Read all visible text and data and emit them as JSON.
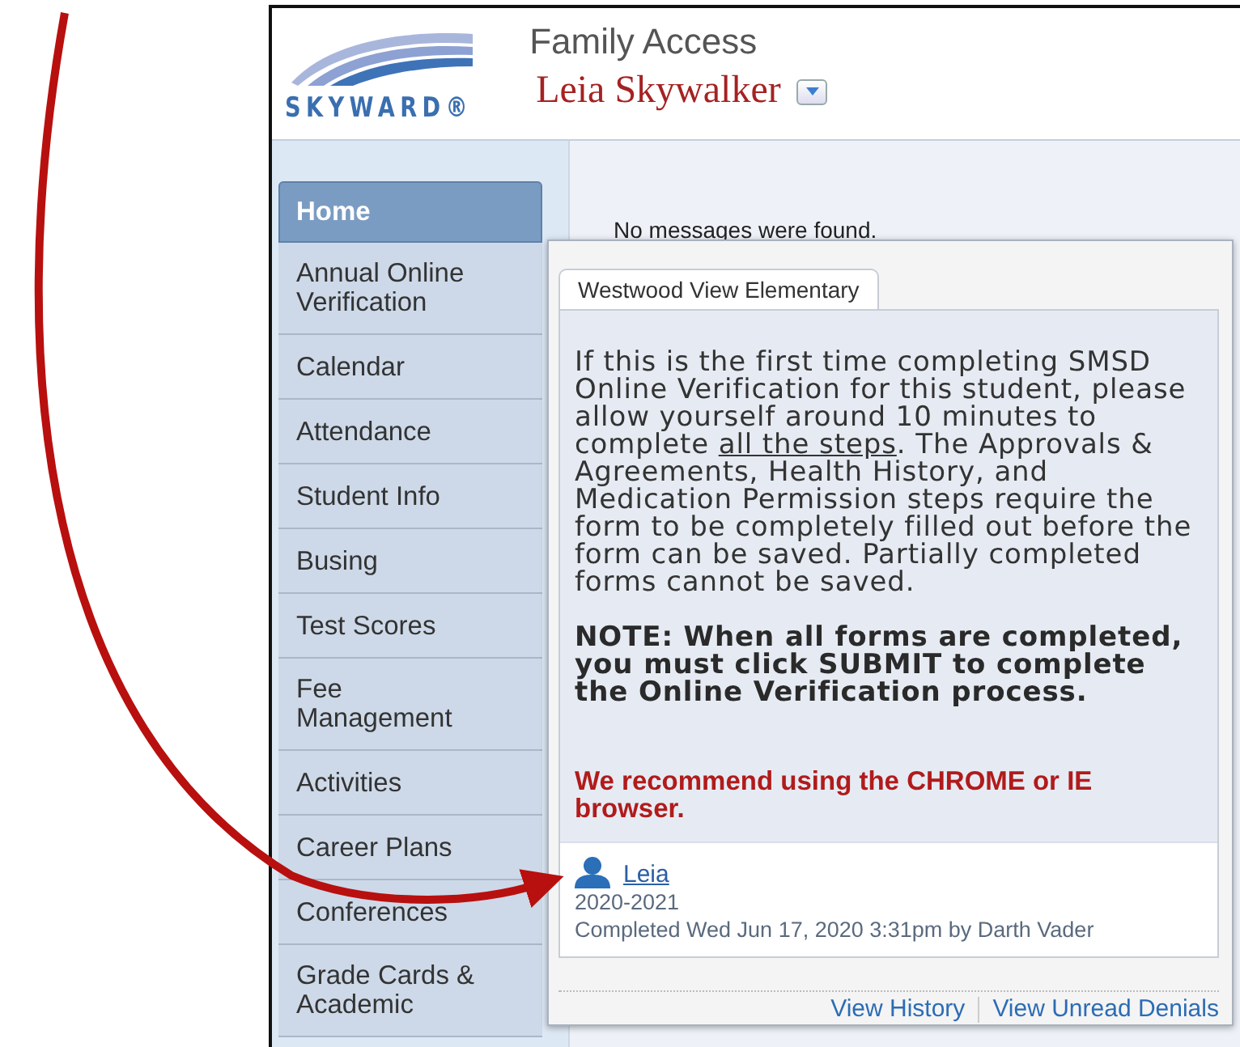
{
  "header": {
    "logo": "SKYWARD®",
    "app_title": "Family Access",
    "student_name": "Leia Skywalker"
  },
  "sidebar": {
    "items": [
      {
        "label": "Home",
        "selected": true
      },
      {
        "label": "Annual Online Verification",
        "selected": false
      },
      {
        "label": "Calendar",
        "selected": false
      },
      {
        "label": "Attendance",
        "selected": false
      },
      {
        "label": "Student Info",
        "selected": false
      },
      {
        "label": "Busing",
        "selected": false
      },
      {
        "label": "Test Scores",
        "selected": false
      },
      {
        "label": "Fee Management",
        "selected": false
      },
      {
        "label": "Activities",
        "selected": false
      },
      {
        "label": "Career Plans",
        "selected": false
      },
      {
        "label": "Conferences",
        "selected": false
      },
      {
        "label": "Grade Cards & Academic",
        "selected": false
      }
    ]
  },
  "messages": "No messages were found.",
  "popup": {
    "tabs": [
      {
        "label": "Westwood View Elementary",
        "selected": true
      }
    ],
    "intro": {
      "before": "If this is the first time completing SMSD Online Verification for this student, please allow yourself around 10 minutes to complete ",
      "underlined": "all the steps",
      "after": ".   The Approvals & Agreements, Health History, and Medication Permission steps require the form to be completely filled out before the form can be saved. Partially completed forms cannot be saved."
    },
    "note": "NOTE: When all forms are completed, you must click SUBMIT to complete the Online Verification process.",
    "warning": "We recommend using the CHROME or IE browser.",
    "student": {
      "name": "Leia",
      "year": "2020-2021",
      "status": "Completed Wed Jun 17, 2020 3:31pm by Darth Vader"
    },
    "links": [
      "View History",
      "View Unread Denials"
    ]
  }
}
